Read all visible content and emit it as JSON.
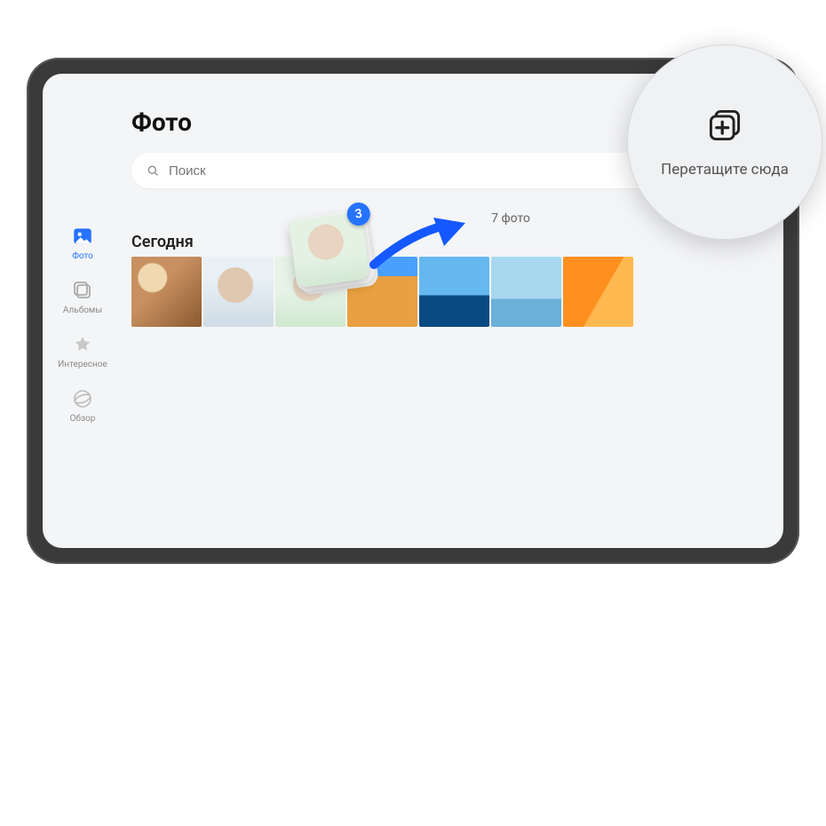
{
  "page": {
    "title": "Фото"
  },
  "search": {
    "placeholder": "Поиск"
  },
  "sidebar": {
    "items": [
      {
        "label": "Фото",
        "active": true
      },
      {
        "label": "Альбомы"
      },
      {
        "label": "Интересное"
      },
      {
        "label": "Обзор"
      }
    ]
  },
  "main": {
    "count_label": "7 фото",
    "section_title": "Сегодня",
    "drag_badge": "3"
  },
  "magnifier": {
    "label": "Перетащите сюда"
  },
  "colors": {
    "accent": "#2673ff"
  }
}
